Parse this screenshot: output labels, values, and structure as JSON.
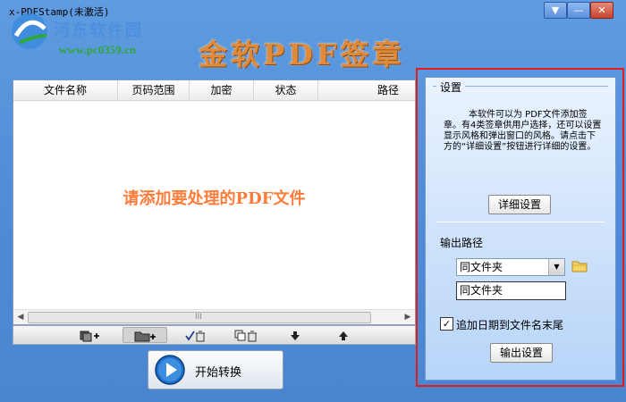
{
  "window": {
    "title": "x-PDFStamp(未激活)",
    "controls": {
      "menu": "▼",
      "minimize": "—",
      "close": "✕"
    }
  },
  "branding": {
    "site_name": "河东软件园",
    "site_url": "www.pc0359.cn",
    "app_heading": "金软PDF签章"
  },
  "file_list": {
    "columns": [
      "文件名称",
      "页码范围",
      "加密",
      "状态",
      "路径"
    ],
    "empty_hint": "请添加要处理的PDF文件",
    "scroll_grip": "III"
  },
  "toolbar": {
    "items": [
      {
        "icon": "add-file-icon"
      },
      {
        "icon": "add-folder-icon"
      },
      {
        "icon": "delete-checked-icon"
      },
      {
        "icon": "delete-all-icon"
      },
      {
        "icon": "move-down-icon"
      },
      {
        "icon": "move-up-icon"
      }
    ]
  },
  "start_button": {
    "label": "开始转换"
  },
  "settings": {
    "group_title": "设置",
    "description": "本软件可以为 PDF文件添加签章。有4类签章供用户选择，还可以设置显示风格和弹出窗口的风格。请点击下方的“详细设置”按钮进行详细的设置。",
    "detail_button": "详细设置",
    "output_path_label": "输出路径",
    "path_select_value": "同文件夹",
    "path_input_value": "同文件夹",
    "append_date_label": "追加日期到文件名末尾",
    "append_date_checked": true,
    "append_date_mark": "✓",
    "output_settings_button": "输出设置"
  },
  "colors": {
    "window_bg": "#4e8ad6",
    "highlight_border": "#e21d1d",
    "hint_text": "#ff7c3a",
    "brand_title": "#e08a3a"
  }
}
